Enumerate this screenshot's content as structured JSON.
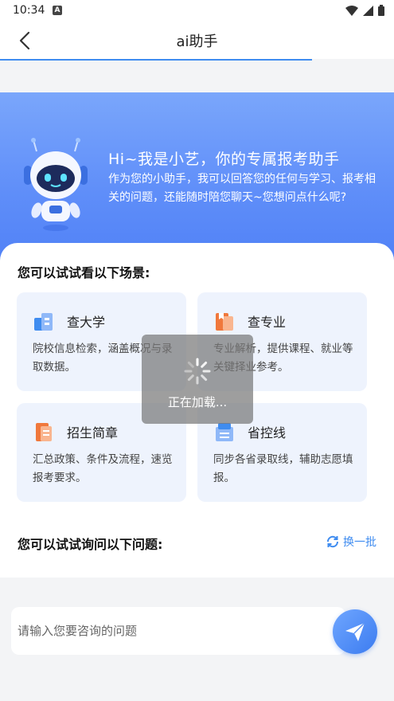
{
  "status_bar": {
    "time": "10:34",
    "notification_icon": "A"
  },
  "app_bar": {
    "title": "ai助手"
  },
  "hero": {
    "title": "Hi~我是小艺，你的专属报考助手",
    "description": "作为您的小助手，我可以回答您的任何与学习、报考相关的问题，还能随时陪您聊天~您想问点什么呢?"
  },
  "scenarios": {
    "title": "您可以试试看以下场景:",
    "cards": [
      {
        "title": "查大学",
        "description": "院校信息检索，涵盖概况与录取数据。",
        "icon": "university-icon"
      },
      {
        "title": "查专业",
        "description": "专业解析，提供课程、就业等关键择业参考。",
        "icon": "major-icon"
      },
      {
        "title": "招生简章",
        "description": "汇总政策、条件及流程，速览报考要求。",
        "icon": "brochure-icon"
      },
      {
        "title": "省控线",
        "description": "同步各省录取线，辅助志愿填报。",
        "icon": "score-line-icon"
      }
    ]
  },
  "questions": {
    "title": "您可以试试询问以下问题:",
    "swap_label": "换一批"
  },
  "input": {
    "placeholder": "请输入您要咨询的问题",
    "value": ""
  },
  "loading": {
    "text": "正在加载..."
  },
  "colors": {
    "accent": "#3f8cf0",
    "hero": "#5f8ef9",
    "card_bg": "#eef3fd",
    "icon_orange": "#f0783c"
  }
}
